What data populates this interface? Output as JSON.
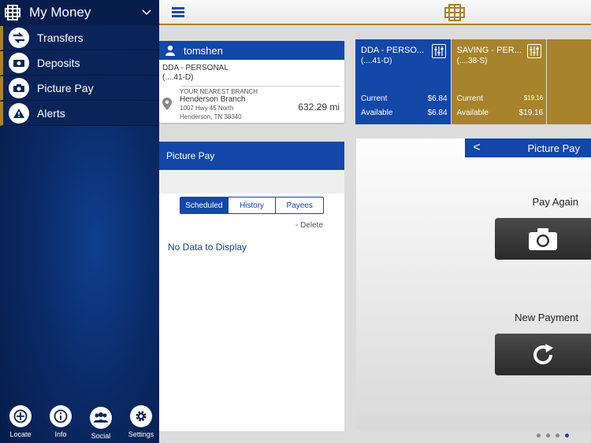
{
  "sidebar": {
    "title": "My Money",
    "items": [
      {
        "label": "Transfers",
        "icon": "transfer-arrows-icon"
      },
      {
        "label": "Deposits",
        "icon": "deposit-camera-icon"
      },
      {
        "label": "Picture Pay",
        "icon": "camera-icon"
      },
      {
        "label": "Alerts",
        "icon": "alert-triangle-icon"
      }
    ],
    "bottom": [
      {
        "label": "Locate",
        "icon": "plus-circle-icon"
      },
      {
        "label": "Info",
        "icon": "info-icon"
      },
      {
        "label": "Social",
        "icon": "people-icon"
      },
      {
        "label": "Settings",
        "icon": "gear-icon"
      }
    ]
  },
  "account_card": {
    "username": "tomshen",
    "account_name": "DDA - PERSONAL",
    "account_number": "(....41-D)",
    "branch_heading": "YOUR NEAREST BRANCH",
    "branch_name": "Henderson Branch",
    "address1": "1007 Hwy 45 North",
    "address2": "Henderson, TN 38340",
    "distance": "632.29 mi"
  },
  "tiles": [
    {
      "name": "DDA - PERSO...",
      "number": "(....41-D)",
      "current_label": "Current",
      "current": "$6.84",
      "available_label": "Available",
      "available": "$6.84"
    },
    {
      "name": "SAVING - PER...",
      "number": "(....38-S)",
      "current_label": "Current",
      "current": "$19.16",
      "available_label": "Available",
      "available": "$19.16"
    }
  ],
  "picture_pay": {
    "header": "Picture Pay",
    "tabs": [
      "Scheduled",
      "History",
      "Payees"
    ],
    "active_tab": "Scheduled",
    "delete_label": "- Delete",
    "empty_text": "No Data to Display"
  },
  "right_panel": {
    "back": "<",
    "title": "Picture Pay",
    "pay_again": "Pay Again",
    "new_payment": "New Payment"
  },
  "colors": {
    "brand_blue": "#1347a8",
    "gold": "#a7832c",
    "navy": "#0a2459"
  }
}
